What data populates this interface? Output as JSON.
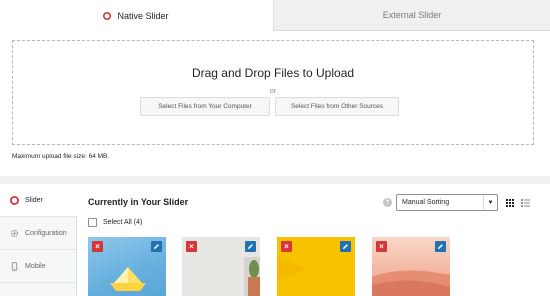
{
  "tabs": [
    {
      "label": "Native Slider",
      "active": true,
      "icon": "lifebuoy-icon"
    },
    {
      "label": "External Slider",
      "active": false
    }
  ],
  "upload": {
    "title": "Drag and Drop Files to Upload",
    "or": "or",
    "btn_computer": "Select Files from Your Computer",
    "btn_other": "Select Files from Other Sources",
    "max_size": "Maximum upload file size: 64 MB."
  },
  "side_nav": [
    {
      "label": "Slider",
      "icon": "lifebuoy-icon",
      "active": true
    },
    {
      "label": "Configuration",
      "icon": "gear-icon",
      "active": false
    },
    {
      "label": "Mobile",
      "icon": "mobile-icon",
      "active": false
    }
  ],
  "main": {
    "title": "Currently in Your Slider",
    "select_all": "Select All (4)",
    "sort_value": "Manual Sorting"
  },
  "slides": [
    {
      "name": "paper-boat",
      "color": "#66b0de"
    },
    {
      "name": "cactus",
      "color": "#e8e6e2"
    },
    {
      "name": "yellow",
      "color": "#f7c200"
    },
    {
      "name": "desert",
      "color": "#f3b8a3"
    }
  ],
  "colors": {
    "accent_red": "#d63638",
    "accent_blue": "#2271b1",
    "panel_bg": "#ffffff",
    "page_bg": "#f0f0f1"
  }
}
